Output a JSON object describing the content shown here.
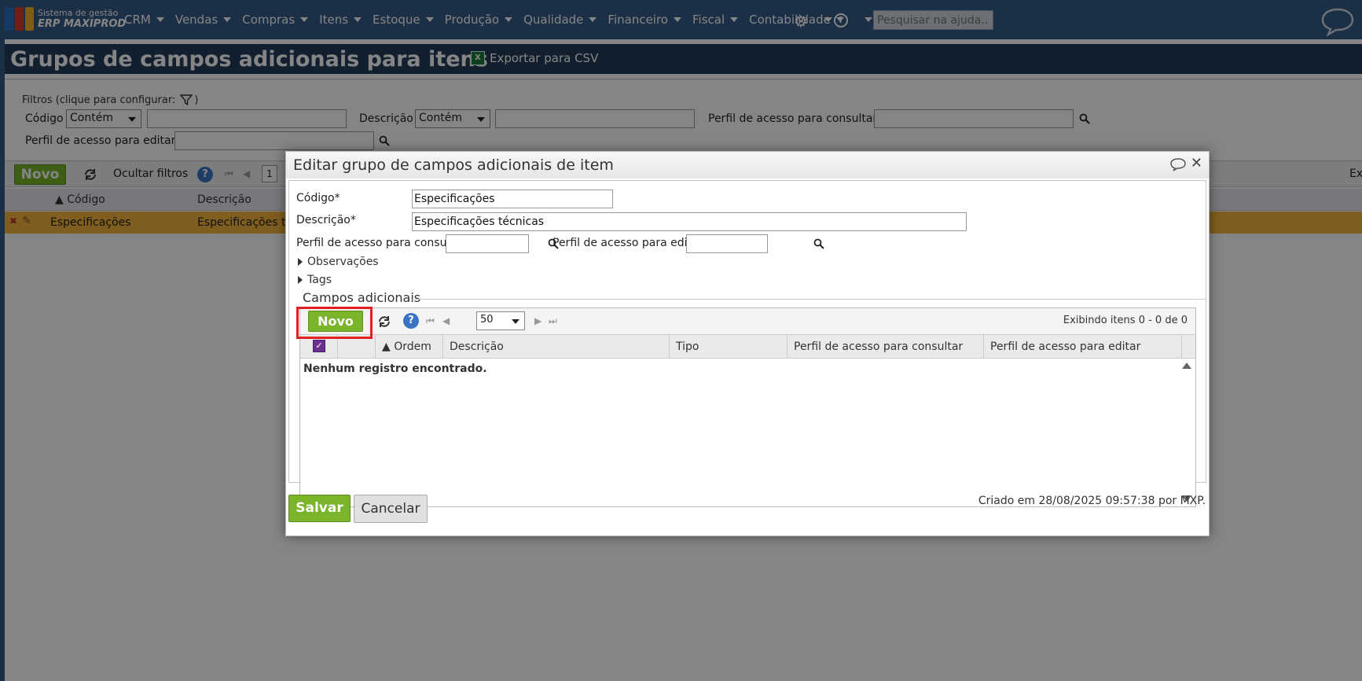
{
  "colors": {
    "topbar": "#355a86",
    "page_header": "#243d5a",
    "accent_green": "#79b42a",
    "selected_row": "#f3b43c",
    "highlight_red": "#e02020"
  },
  "brand": {
    "line1": "Sistema de gestão",
    "line2": "ERP MAXIPROD"
  },
  "menu": [
    {
      "label": "CRM"
    },
    {
      "label": "Vendas"
    },
    {
      "label": "Compras"
    },
    {
      "label": "Itens"
    },
    {
      "label": "Estoque"
    },
    {
      "label": "Produção"
    },
    {
      "label": "Qualidade"
    },
    {
      "label": "Financeiro"
    },
    {
      "label": "Fiscal"
    },
    {
      "label": "Contabilidade"
    }
  ],
  "help_search": {
    "placeholder": "Pesquisar na ajuda..."
  },
  "page": {
    "title": "Grupos de campos adicionais para itens",
    "export_label": "Exportar para CSV",
    "export_icon": "excel-icon"
  },
  "filters": {
    "legend": "Filtros (clique para configurar:",
    "legend_close": ")",
    "codigo_label": "Código",
    "codigo_op": "Contém",
    "descricao_label": "Descrição",
    "descricao_op": "Contém",
    "perfil_consultar_label": "Perfil de acesso para consultar",
    "perfil_editar_label": "Perfil de acesso para editar"
  },
  "grid": {
    "new_button": "Novo",
    "hide_filters": "Ocultar filtros",
    "page_number": "1",
    "right_clip": "Ex",
    "columns": [
      "Código",
      "Descrição"
    ],
    "rows": [
      {
        "codigo": "Especificações",
        "descricao": "Especificações te"
      }
    ]
  },
  "modal": {
    "title": "Editar grupo de campos adicionais de item",
    "codigo_label": "Código*",
    "codigo_value": "Especificações",
    "descricao_label": "Descrição*",
    "descricao_value": "Especificações técnicas",
    "perfil_consultar_label": "Perfil de acesso para consultar",
    "perfil_editar_label": "Perfil de acesso para editar",
    "observacoes_label": "Observações",
    "tags_label": "Tags",
    "section_title": "Campos adicionais",
    "sub_grid": {
      "new_button": "Novo",
      "page_size": "50",
      "status": "Exibindo itens 0 - 0 de 0",
      "columns": [
        "Ordem",
        "Descrição",
        "Tipo",
        "Perfil de acesso para consultar",
        "Perfil de acesso para editar"
      ],
      "empty_message": "Nenhum registro encontrado."
    },
    "save_button": "Salvar",
    "cancel_button": "Cancelar",
    "created_text": "Criado em 28/08/2025 09:57:38 por MXP."
  }
}
